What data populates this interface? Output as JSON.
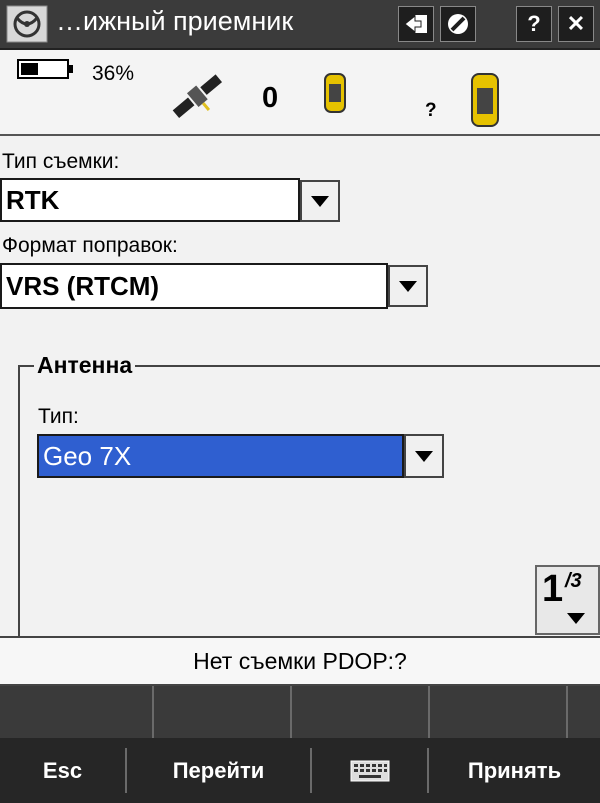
{
  "title_bar": {
    "title": "…ижный приемник",
    "buttons": {
      "switch": "switch-icon",
      "no": "no-icon",
      "help": "?",
      "close": "✕"
    }
  },
  "status_bar": {
    "battery_percent": "36%",
    "satellite_count": "0",
    "rover_status": "?"
  },
  "form": {
    "survey_type_label": "Тип съемки:",
    "survey_type_value": "RTK",
    "correction_format_label": "Формат поправок:",
    "correction_format_value": "VRS (RTCM)",
    "antenna_group_title": "Антенна",
    "antenna_type_label": "Тип:",
    "antenna_type_value": "Geo 7X"
  },
  "pager": {
    "current": "1",
    "total": "/3"
  },
  "status_line": "Нет съемки  PDOP:?",
  "softkeys": {
    "esc": "Esc",
    "goto": "Перейти",
    "keyboard": "keyboard-icon",
    "accept": "Принять"
  },
  "colors": {
    "title_bg": "#3b3b3b",
    "selected_bg": "#2f5fd0",
    "softkey_bg": "#262626"
  }
}
